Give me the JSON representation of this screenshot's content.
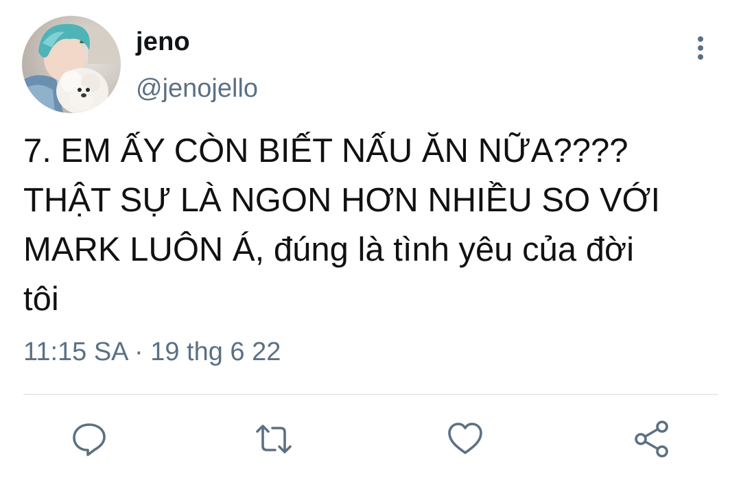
{
  "tweet": {
    "author": {
      "display_name": "jeno",
      "handle": "@jenojello"
    },
    "text": "7. EM ẤY CÒN BIẾT NẤU ĂN NỮA????\nTHẬT SỰ LÀ NGON HƠN NHIỀU SO VỚI\nMARK LUÔN Á, đúng là tình yêu của đời\ntôi",
    "timestamp": "11:15 SA · 19 thg 6 22"
  },
  "actions": {
    "reply": "reply-icon",
    "retweet": "retweet-icon",
    "like": "heart-icon",
    "share": "share-icon"
  },
  "colors": {
    "text_primary": "#0f1419",
    "text_secondary": "#5b7083",
    "icon": "#5b7083",
    "divider": "#e6ecf0",
    "avatar_hair": "#4fb3b8"
  }
}
